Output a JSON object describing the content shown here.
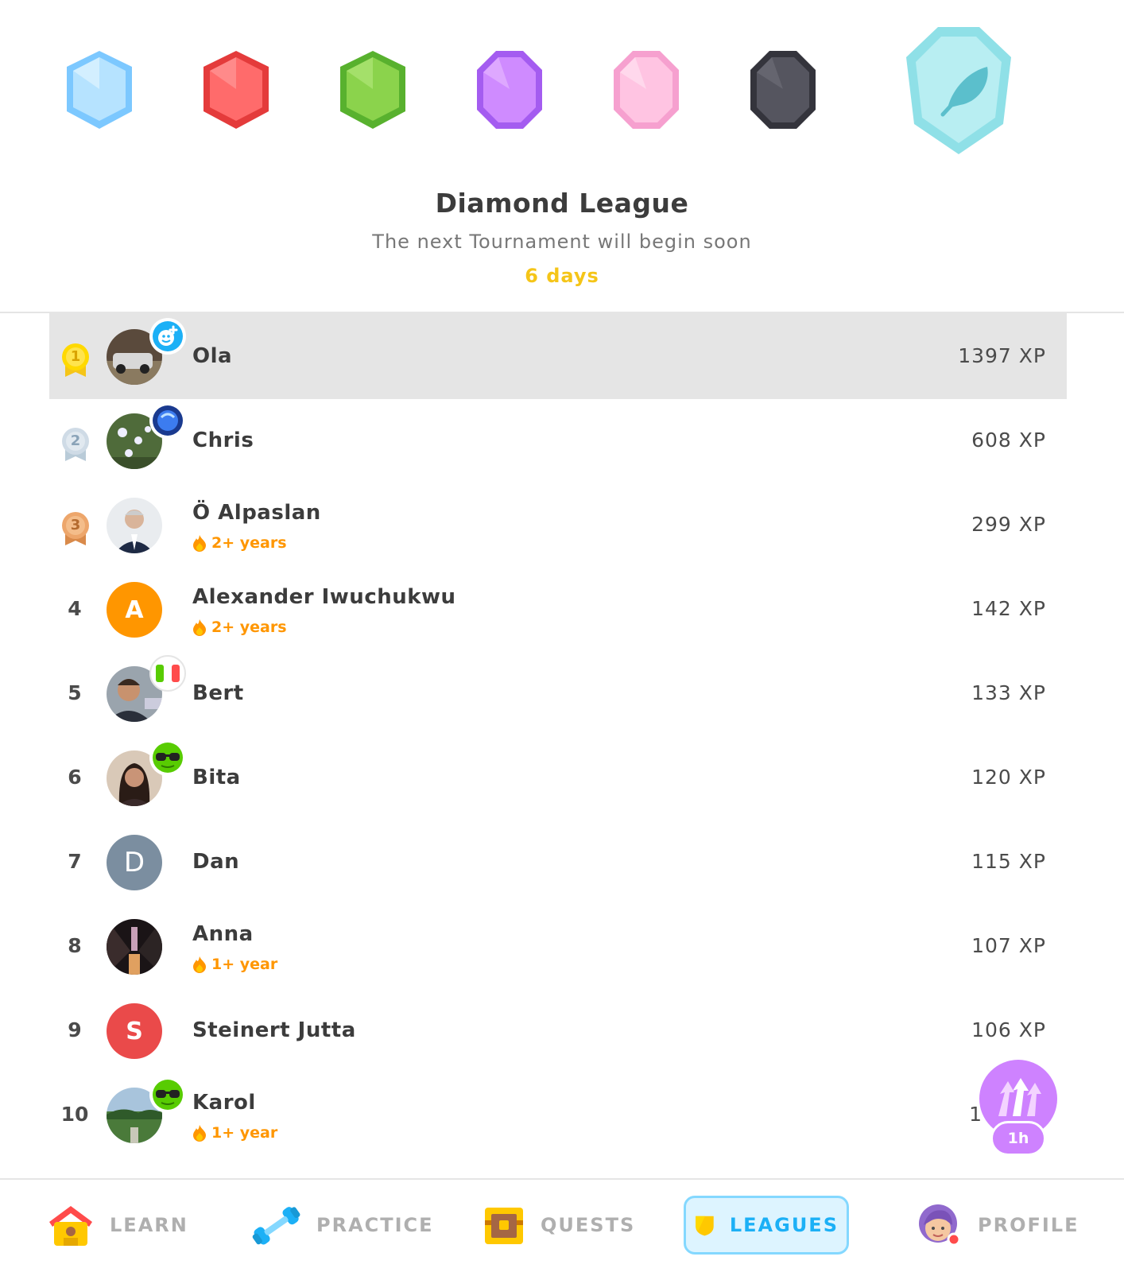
{
  "league": {
    "title": "Diamond League",
    "subtitle": "The next Tournament will begin soon",
    "countdown": "6 days",
    "badges": [
      {
        "icon": "sapphire-league-badge-icon",
        "color": "#8fd3ff"
      },
      {
        "icon": "ruby-league-badge-icon",
        "color": "#ff5a5a"
      },
      {
        "icon": "emerald-league-badge-icon",
        "color": "#7ac74f"
      },
      {
        "icon": "amethyst-league-badge-icon",
        "color": "#c27cff"
      },
      {
        "icon": "pearl-league-badge-icon",
        "color": "#ffadd6"
      },
      {
        "icon": "obsidian-league-badge-icon",
        "color": "#4b4b55"
      },
      {
        "icon": "diamond-league-badge-icon",
        "color": "#9de5ec"
      }
    ]
  },
  "leaderboard": [
    {
      "rank": "1",
      "medal": "gold-medal-icon",
      "name": "Ola",
      "xp": "1397 XP",
      "avatar": "photo",
      "sticker": "smiley-plus-icon",
      "highlighted": true
    },
    {
      "rank": "2",
      "medal": "silver-medal-icon",
      "name": "Chris",
      "xp": "608 XP",
      "avatar": "photo",
      "sticker": "blue-gem-icon"
    },
    {
      "rank": "3",
      "medal": "bronze-medal-icon",
      "name": "Ö Alpaslan",
      "streak": "2+ years",
      "xp": "299 XP",
      "avatar": "photo"
    },
    {
      "rank": "4",
      "name": "Alexander Iwuchukwu",
      "streak": "2+ years",
      "xp": "142 XP",
      "avatar_letter": "A",
      "avatar_color": "#ff9600"
    },
    {
      "rank": "5",
      "name": "Bert",
      "xp": "133 XP",
      "avatar": "photo",
      "sticker": "italy-flag-icon"
    },
    {
      "rank": "6",
      "name": "Bita",
      "xp": "120 XP",
      "avatar": "photo",
      "sticker": "sunglasses-icon"
    },
    {
      "rank": "7",
      "name": "Dan",
      "xp": "115 XP",
      "avatar_letter": "D",
      "avatar_color": "#7b8ea0"
    },
    {
      "rank": "8",
      "name": "Anna",
      "streak": "1+ year",
      "xp": "107 XP",
      "avatar": "photo"
    },
    {
      "rank": "9",
      "name": "Steinert Jutta",
      "xp": "106 XP",
      "avatar_letter": "S",
      "avatar_color": "#ea4a4a"
    },
    {
      "rank": "10",
      "name": "Karol",
      "streak": "1+ year",
      "xp": "1",
      "avatar": "photo",
      "sticker": "sunglasses-icon"
    }
  ],
  "boost": {
    "icon": "xp-boost-icon",
    "timer": "1h",
    "color": "#ce82ff"
  },
  "nav": {
    "learn": "LEARN",
    "practice": "PRACTICE",
    "quests": "QUESTS",
    "leagues": "LEAGUES",
    "profile": "PROFILE",
    "active": "leagues"
  }
}
